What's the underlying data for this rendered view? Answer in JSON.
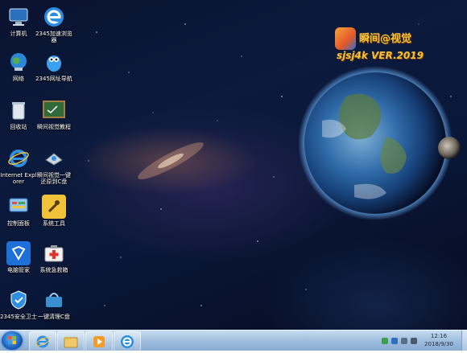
{
  "desktop": {
    "icons": [
      {
        "label": "计算机",
        "icon": "computer-icon"
      },
      {
        "label": "2345加速浏览器",
        "icon": "browser-e-icon"
      },
      {
        "label": "网络",
        "icon": "network-globe-icon"
      },
      {
        "label": "2345网址导航",
        "icon": "penguin-icon"
      },
      {
        "label": "回收站",
        "icon": "recycle-bin-icon"
      },
      {
        "label": "瞬间视觉教程",
        "icon": "blackboard-icon"
      },
      {
        "label": "Internet Explorer",
        "icon": "ie-icon"
      },
      {
        "label": "瞬间视觉一键还原到C盘",
        "icon": "restore-disk-icon"
      },
      {
        "label": "控制面板",
        "icon": "control-panel-icon"
      },
      {
        "label": "系统工具",
        "icon": "tools-icon"
      },
      {
        "label": "电脑管家",
        "icon": "shield-manager-icon"
      },
      {
        "label": "系统急救箱",
        "icon": "first-aid-icon"
      },
      {
        "label": "2345安全卫士",
        "icon": "security-shield-icon"
      },
      {
        "label": "一键清理C盘",
        "icon": "cleanup-icon"
      }
    ]
  },
  "brand": {
    "title": "瞬间@视觉",
    "subtitle": "sjsj4k VER.2019"
  },
  "taskbar": {
    "apps": [
      {
        "name": "internet-explorer",
        "icon": "ie-icon"
      },
      {
        "name": "file-explorer",
        "icon": "folder-icon"
      },
      {
        "name": "media-player",
        "icon": "play-icon"
      },
      {
        "name": "2345-browser",
        "icon": "browser-e-icon"
      }
    ],
    "clock": {
      "time": "12:16",
      "date": "2018/9/30"
    }
  },
  "colors": {
    "taskbar_top": "#c7dbef",
    "taskbar_bottom": "#89abd2",
    "brand_text": "#f2c23a"
  }
}
